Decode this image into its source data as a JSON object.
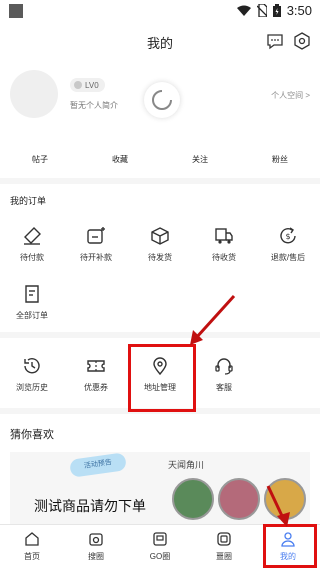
{
  "status_bar": {
    "time": "3:50"
  },
  "header": {
    "title": "我的"
  },
  "profile": {
    "level": "LV0",
    "bio": "暂无个人简介",
    "space_link": "个人空间 >",
    "stats": [
      "帖子",
      "收藏",
      "关注",
      "粉丝"
    ]
  },
  "orders": {
    "title": "我的订单",
    "items": [
      {
        "label": "待付款",
        "icon": "pay-icon"
      },
      {
        "label": "待开补款",
        "icon": "invoice-icon"
      },
      {
        "label": "待发货",
        "icon": "box-icon"
      },
      {
        "label": "待收货",
        "icon": "truck-icon"
      },
      {
        "label": "退款/售后",
        "icon": "refund-icon"
      },
      {
        "label": "全部订单",
        "icon": "list-icon"
      }
    ]
  },
  "services": {
    "items": [
      {
        "label": "浏览历史",
        "icon": "history-icon"
      },
      {
        "label": "优惠券",
        "icon": "coupon-icon"
      },
      {
        "label": "地址管理",
        "icon": "location-icon"
      },
      {
        "label": "客服",
        "icon": "headset-icon"
      }
    ]
  },
  "guess": {
    "title": "猜你喜欢",
    "banner_badge": "活动预告",
    "banner_text": "测试商品请勿下单",
    "banner_brand": "天闻角川"
  },
  "tabbar": {
    "items": [
      {
        "label": "首页",
        "icon": "home-icon"
      },
      {
        "label": "搜圈",
        "icon": "camera-icon"
      },
      {
        "label": "GO圈",
        "icon": "go-icon"
      },
      {
        "label": "噩圈",
        "icon": "square-icon"
      },
      {
        "label": "我的",
        "icon": "person-icon"
      }
    ],
    "active_index": 4
  },
  "colors": {
    "accent": "#4a7ef0",
    "highlight": "#e01010"
  }
}
